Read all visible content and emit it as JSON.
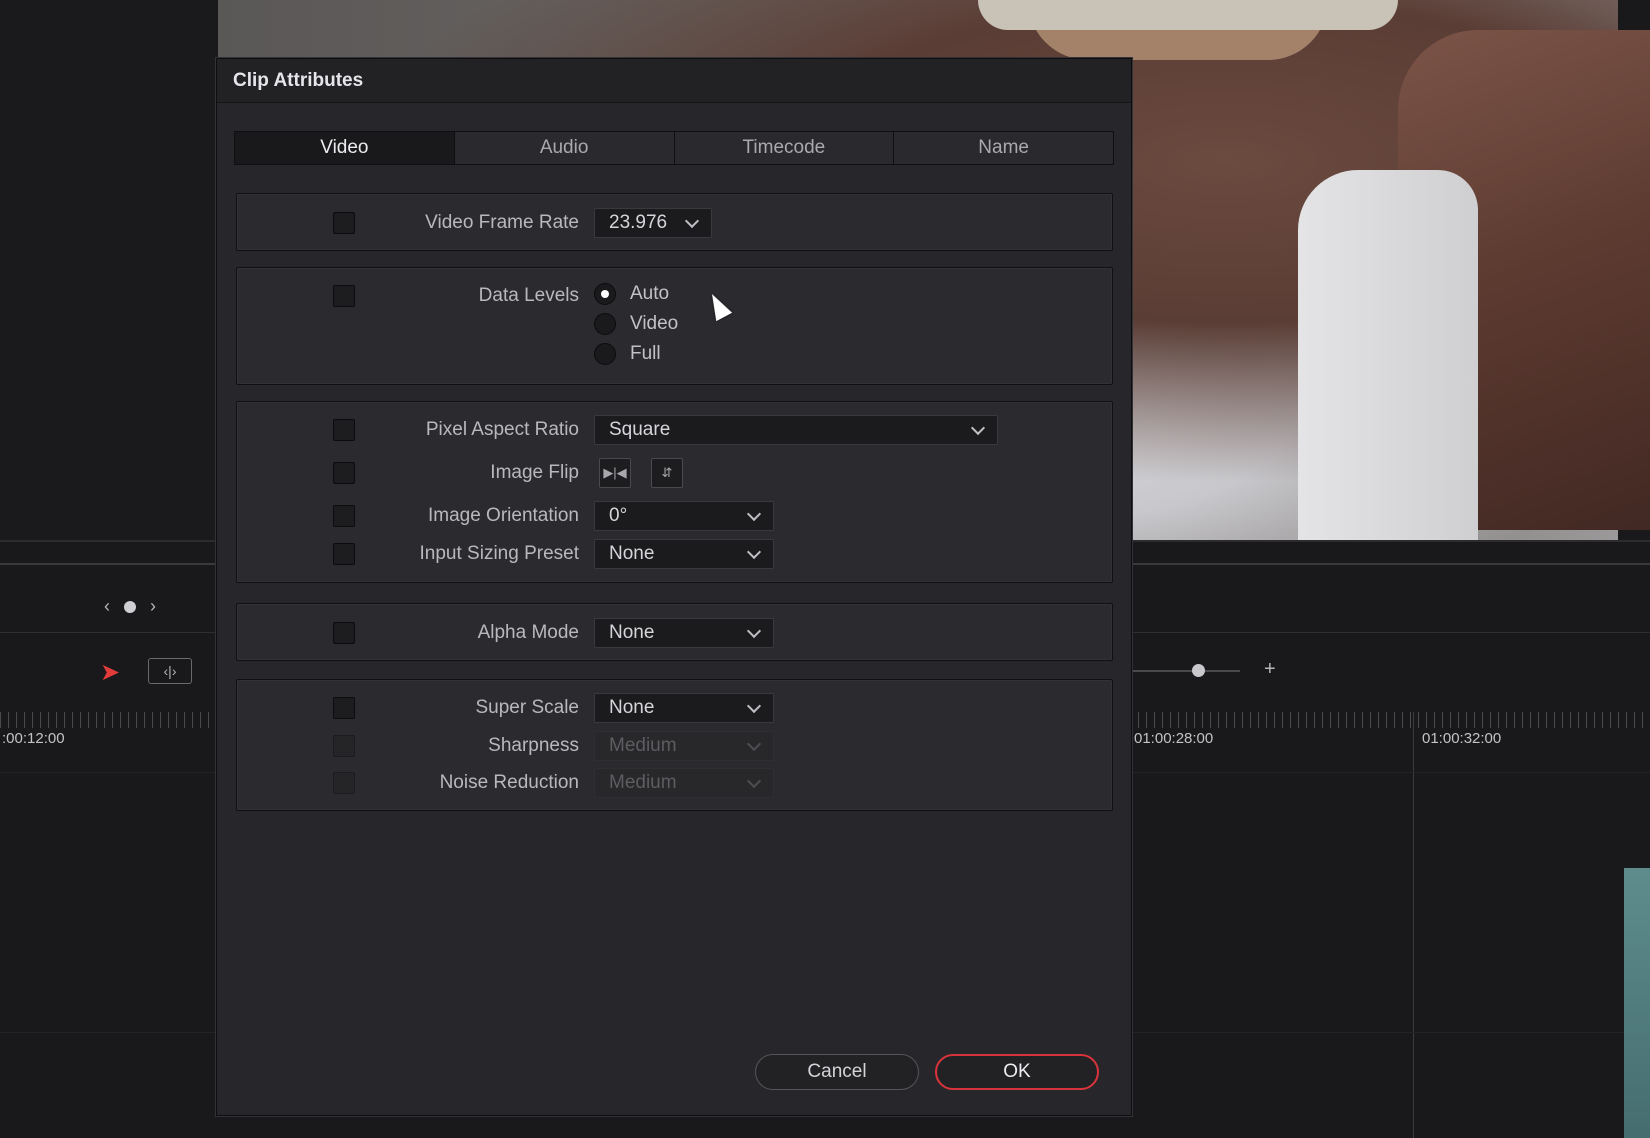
{
  "dialog": {
    "title": "Clip Attributes"
  },
  "tabs": [
    {
      "label": "Video",
      "active": true
    },
    {
      "label": "Audio",
      "active": false
    },
    {
      "label": "Timecode",
      "active": false
    },
    {
      "label": "Name",
      "active": false
    }
  ],
  "video": {
    "frame_rate": {
      "label": "Video Frame Rate",
      "value": "23.976"
    },
    "data_levels": {
      "label": "Data Levels",
      "options": [
        "Auto",
        "Video",
        "Full"
      ],
      "selected": "Auto"
    },
    "pixel_aspect": {
      "label": "Pixel Aspect Ratio",
      "value": "Square"
    },
    "image_flip": {
      "label": "Image Flip"
    },
    "image_orientation": {
      "label": "Image Orientation",
      "value": "0°"
    },
    "input_sizing": {
      "label": "Input Sizing Preset",
      "value": "None"
    },
    "alpha_mode": {
      "label": "Alpha Mode",
      "value": "None"
    },
    "super_scale": {
      "label": "Super Scale",
      "value": "None"
    },
    "sharpness": {
      "label": "Sharpness",
      "value": "Medium"
    },
    "noise_reduction": {
      "label": "Noise Reduction",
      "value": "Medium"
    }
  },
  "buttons": {
    "cancel": "Cancel",
    "ok": "OK"
  },
  "timeline": {
    "tc_left": ":00:12:00",
    "tc_mid": "01:00:28:00",
    "tc_right": "01:00:32:00"
  },
  "colors": {
    "accent": "#d9333b",
    "panel": "#27272b"
  }
}
